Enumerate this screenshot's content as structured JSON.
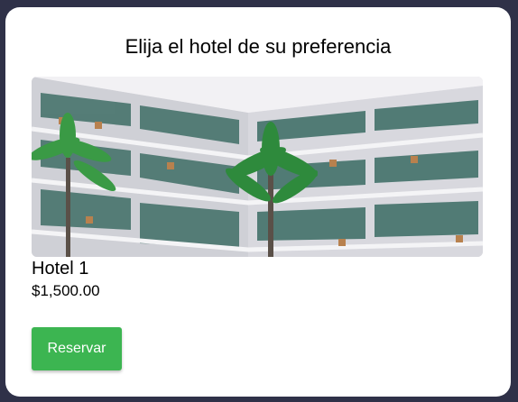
{
  "page": {
    "title": "Elija el hotel de su preferencia"
  },
  "hotel": {
    "image_alt": "hotel-building-photo",
    "name": "Hotel 1",
    "price": "$1,500.00",
    "reserve_label": "Reservar"
  },
  "colors": {
    "background": "#2f3148",
    "card": "#ffffff",
    "button": "#3cb551",
    "button_text": "#ffffff"
  }
}
